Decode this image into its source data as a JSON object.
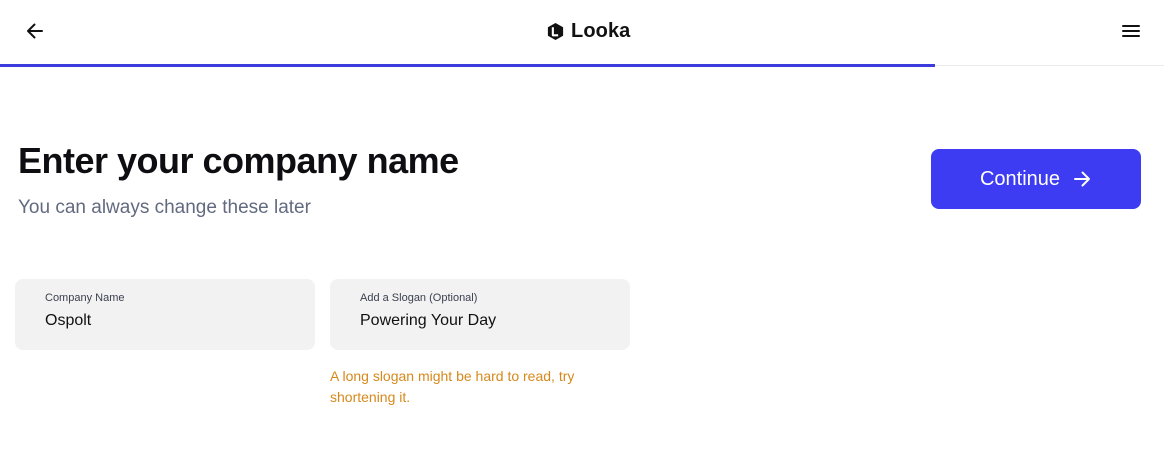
{
  "header": {
    "brand_name": "Looka",
    "progress_percent": 80.3,
    "back_icon": "arrow-left-icon",
    "menu_icon": "hamburger-menu-icon",
    "logo_icon": "looka-logo-icon"
  },
  "main": {
    "title": "Enter your company name",
    "subtitle": "You can always change these later",
    "continue_label": "Continue",
    "continue_icon": "arrow-right-icon"
  },
  "form": {
    "company_name": {
      "label": "Company Name",
      "value": "Ospolt"
    },
    "slogan": {
      "label": "Add a Slogan (Optional)",
      "value": "Powering Your Day",
      "warning": "A long slogan might be hard to read, try shortening it."
    }
  },
  "colors": {
    "accent": "#3d3cf2",
    "progress": "#3c3cdd",
    "warning": "#d6891c",
    "subtitle": "#626a80",
    "field_bg": "#f2f2f2"
  }
}
